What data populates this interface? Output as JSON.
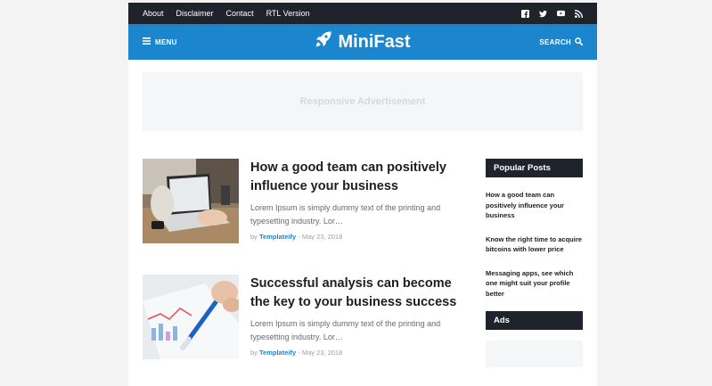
{
  "topbar": {
    "links": [
      "About",
      "Disclaimer",
      "Contact",
      "RTL Version"
    ],
    "social_icons": [
      "facebook-icon",
      "twitter-icon",
      "youtube-icon",
      "rss-icon"
    ]
  },
  "header": {
    "menu_label": "MENU",
    "logo_text": "MiniFast",
    "search_label": "SEARCH"
  },
  "ad": {
    "text": "Responsive Advertisement"
  },
  "posts": [
    {
      "title": "How a good team can positively influence your business",
      "excerpt": "Lorem Ipsum is simply dummy text of the printing and typesetting industry. Lor…",
      "by": "by",
      "author": "Templateify",
      "date": "May 23, 2018"
    },
    {
      "title": "Successful analysis can become the key to your business success",
      "excerpt": "Lorem Ipsum is simply dummy text of the printing and typesetting industry. Lor…",
      "by": "by",
      "author": "Templateify",
      "date": "May 23, 2018"
    }
  ],
  "sidebar": {
    "popular_title": "Popular Posts",
    "popular_items": [
      "How a good team can positively influence your business",
      "Know the right time to acquire bitcoins with lower price",
      "Messaging apps, see which one might suit your profile better"
    ],
    "ads_title": "Ads"
  },
  "colors": {
    "topbar": "#1f232b",
    "header": "#1b86cd",
    "accent": "#1b86cd",
    "background": "#f3f3f3"
  }
}
